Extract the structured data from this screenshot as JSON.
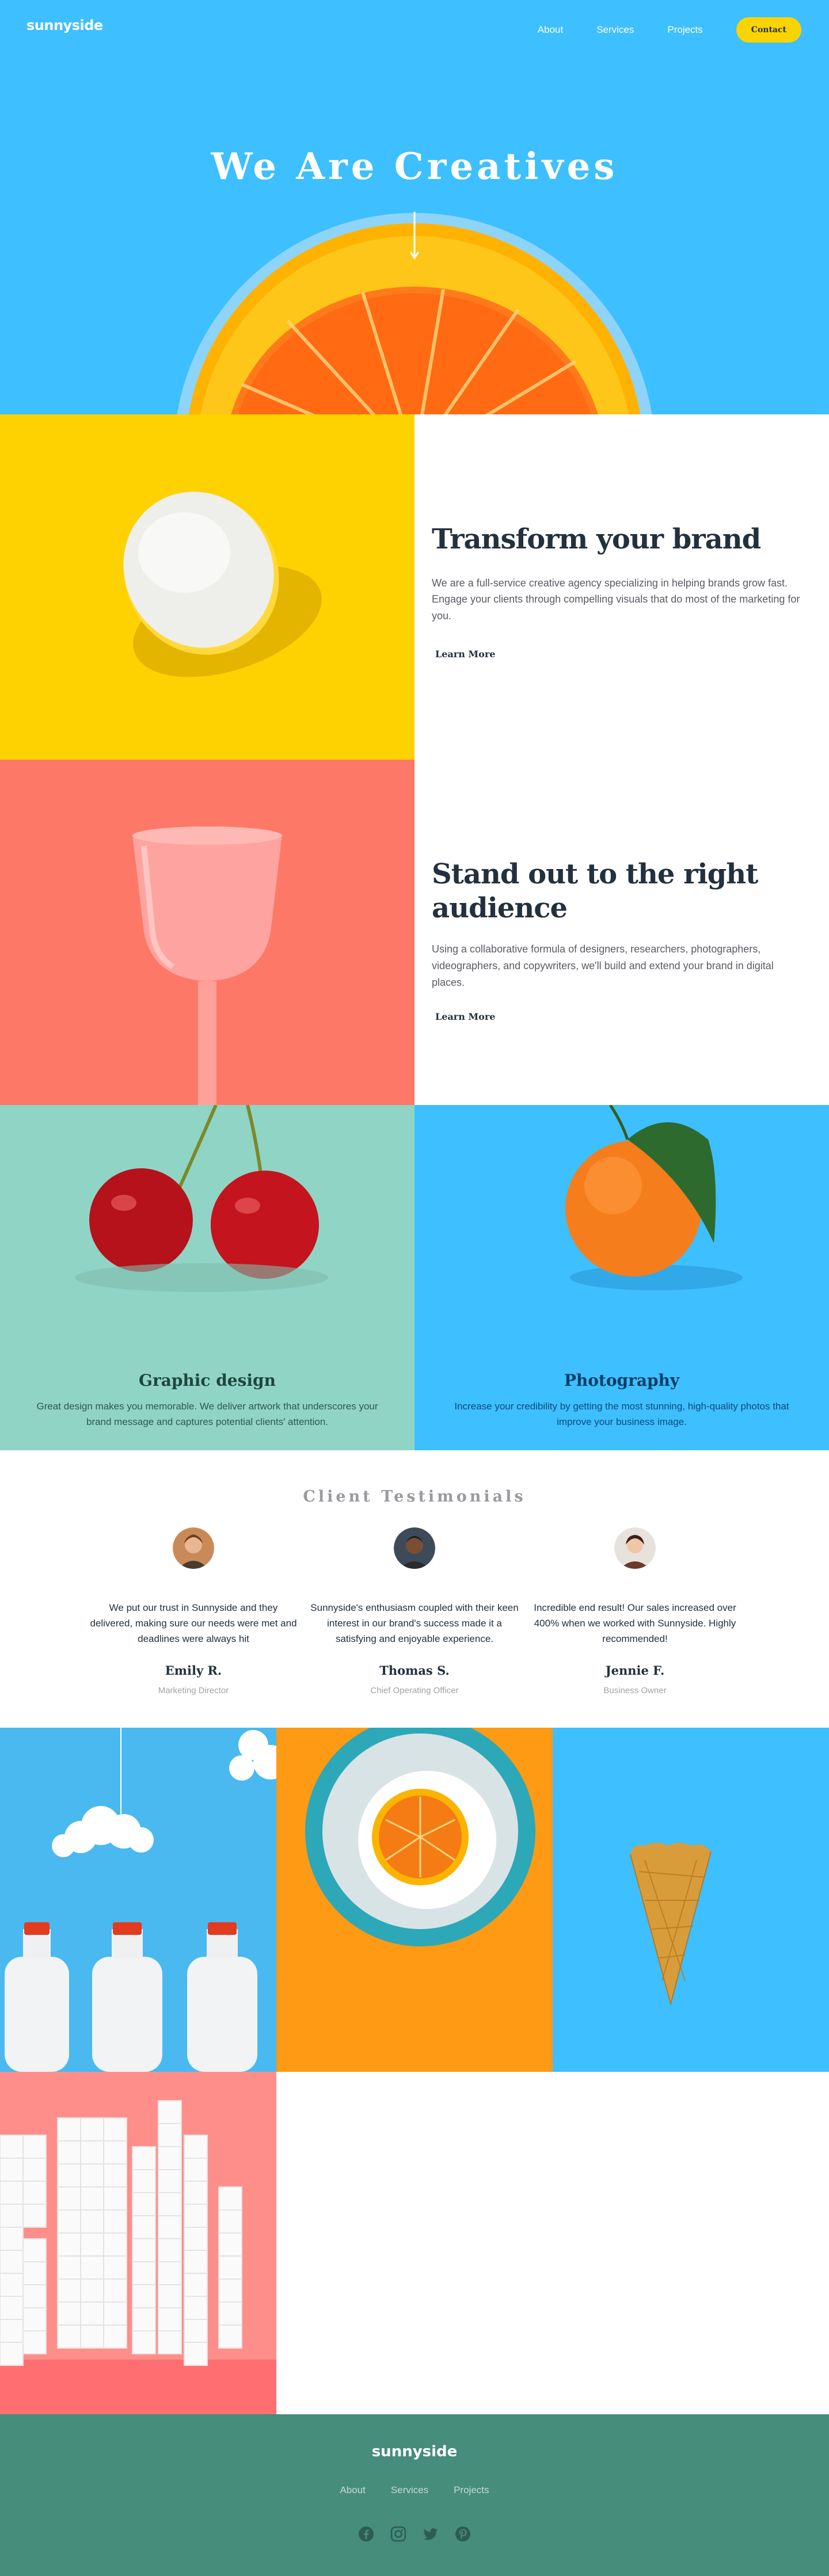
{
  "header": {
    "logo": "sunnyside",
    "nav": [
      {
        "label": "About"
      },
      {
        "label": "Services"
      },
      {
        "label": "Projects"
      }
    ],
    "contact_label": "Contact"
  },
  "hero": {
    "title": "We Are Creatives"
  },
  "features": [
    {
      "title": "Transform your brand",
      "body": "We are a full-service creative agency specializing in helping brands grow fast. Engage your clients through compelling visuals that do most of the marketing for you.",
      "link": "Learn More"
    },
    {
      "title": "Stand out to the right audience",
      "body": "Using a collaborative formula of designers, researchers, photographers, videographers, and copywriters, we'll build and extend your brand in digital places.",
      "link": "Learn More"
    }
  ],
  "services": [
    {
      "title": "Graphic design",
      "body": "Great design makes you memorable. We deliver artwork that underscores your brand message and captures potential clients' attention."
    },
    {
      "title": "Photography",
      "body": "Increase your credibility by getting the most stunning, high-quality photos that improve your business image."
    }
  ],
  "testimonials": {
    "heading": "Client Testimonials",
    "items": [
      {
        "quote": "We put our trust in Sunnyside and they delivered, making sure our needs were met and deadlines were always hit",
        "name": "Emily R.",
        "role": "Marketing Director"
      },
      {
        "quote": "Sunnyside's enthusiasm coupled with their keen interest in our brand's success made it a satisfying and enjoyable experience.",
        "name": "Thomas S.",
        "role": "Chief Operating Officer"
      },
      {
        "quote": "Incredible end result! Our sales increased over 400% when we worked with Sunnyside. Highly recommended!",
        "name": "Jennie F.",
        "role": "Business Owner"
      }
    ]
  },
  "footer": {
    "logo": "sunnyside",
    "nav": [
      {
        "label": "About"
      },
      {
        "label": "Services"
      },
      {
        "label": "Projects"
      }
    ],
    "social": [
      "facebook-icon",
      "instagram-icon",
      "twitter-icon",
      "pinterest-icon"
    ]
  },
  "colors": {
    "hero_blue": "#3ebfff",
    "yellow": "#fad400",
    "coral": "#fe7867",
    "mint": "#90d4c5",
    "footer_green": "#468d7c",
    "dark_text": "#23303e"
  }
}
